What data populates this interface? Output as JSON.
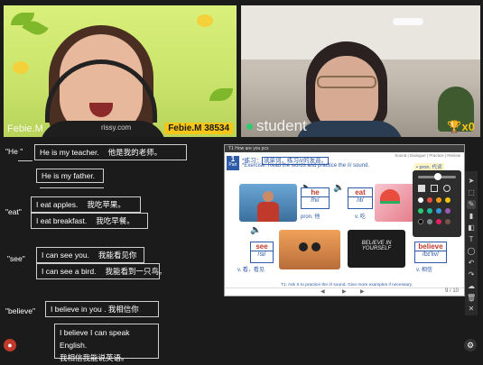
{
  "teacher_video": {
    "name_left": "Febie.M",
    "logo_text": "rissy.com",
    "name_badge": "Febie.M 38534"
  },
  "student_video": {
    "name": "student",
    "trophy": "x0"
  },
  "notes": {
    "he_key": "\"He \"",
    "he_row1_en": "He is my teacher.",
    "he_row1_zh": "他是我的老师。",
    "he_row2_en": "He is my father.",
    "eat_key": "\"eat\"",
    "eat_row1_en": "I eat apples.",
    "eat_row1_zh": "我吃苹果。",
    "eat_row2_en": "I eat breakfast.",
    "eat_row2_zh": "我吃早餐。",
    "see_key": "\"see\"",
    "see_row1_en": "I can see you.",
    "see_row1_zh": "我能看见你",
    "see_row2_en": "I can see a bird.",
    "see_row2_zh": "我能看到一只鸟。",
    "believe_key": "\"believe\"",
    "believe_row1": "I believe in you . 我相信你",
    "believe_row2_en": "I believe I can speak English.",
    "believe_row2_zh": "我相信我能说英语。"
  },
  "slide": {
    "title_bar": "T1 How are you pcs",
    "tabs": "Sound  |  Dialogue  |  Practice  |  Review",
    "part_label": "Part",
    "part_number": "1",
    "exercise_zh_prefix": "*练习：",
    "exercise_zh_highlight": "读单词，练习/i/的发音。",
    "exercise_en": "*Exercise: Read the words and practice the /i/ sound.",
    "pron_tag": "• pron. 代词",
    "words": [
      {
        "word": "he",
        "ipa": "/hi/",
        "pos": "pron. 他"
      },
      {
        "word": "eat",
        "ipa": "/it/",
        "pos": "v. 吃"
      },
      {
        "word": "see",
        "ipa": "/si/",
        "pos": "v. 看，看见"
      },
      {
        "word": "believe",
        "ipa": "/bɪ'liv/",
        "pos": "v. 相信"
      }
    ],
    "poster_text": "BELIEVE IN YOURSELF",
    "footer_note": "T1: Ask S to practice the /i/ sound. Give more examples if necessary.",
    "page_indicator": "9 / 10"
  },
  "colors": {
    "accent_blue": "#2e5aa8",
    "word_red": "#c0392b",
    "badge_yellow": "#f5c518"
  },
  "icons": {
    "toolbar": [
      "pointer-icon",
      "select-icon",
      "pen-icon",
      "highlighter-icon",
      "eraser-icon",
      "text-icon",
      "shape-icon",
      "undo-icon",
      "redo-icon",
      "cloud-icon",
      "trash-icon",
      "clear-icon"
    ]
  }
}
